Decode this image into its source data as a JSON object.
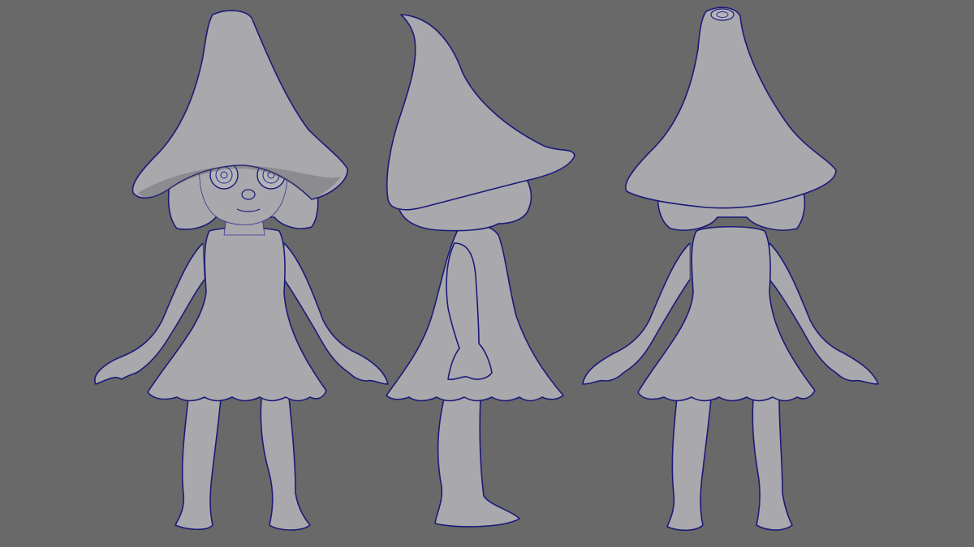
{
  "viewport": {
    "background": "#696969",
    "wire_color": "#23208f",
    "surface_color": "#a9a9ad"
  },
  "views": [
    {
      "view": "front",
      "subject": "gnome-girl-model"
    },
    {
      "view": "side",
      "subject": "gnome-girl-model"
    },
    {
      "view": "back",
      "subject": "gnome-girl-model"
    }
  ]
}
